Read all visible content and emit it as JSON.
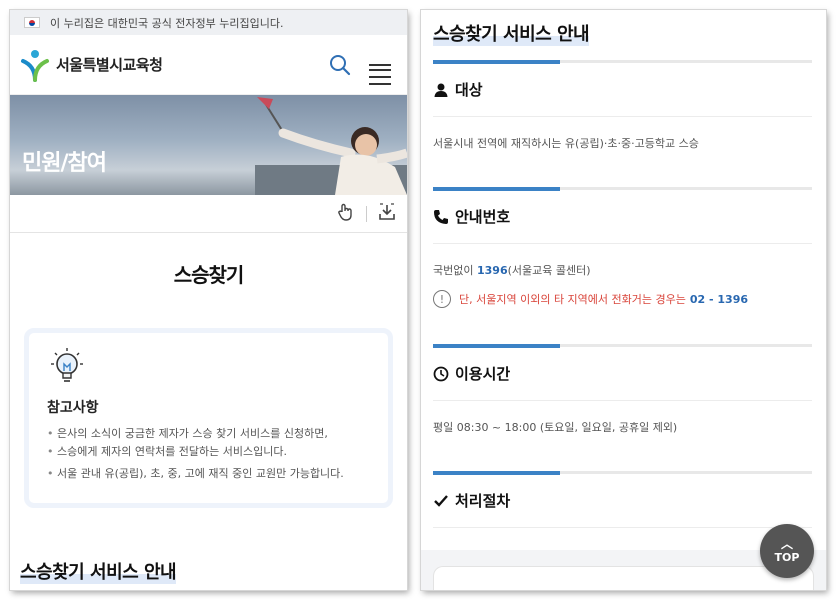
{
  "gov_bar": {
    "text": "이 누리집은 대한민국 공식 전자정부 누리집입니다."
  },
  "header": {
    "logo_text": "서울특별시교육청"
  },
  "banner": {
    "title": "민원/참여"
  },
  "page": {
    "heading": "스승찾기"
  },
  "notice": {
    "title": "참고사항",
    "items": [
      "은사의 소식이 궁금한 제자가 스승 찾기 서비스를 신청하면,",
      "스승에게 제자의 연락처를 전달하는 서비스입니다.",
      "서울 관내 유(공립), 초, 중, 고에 재직 중인 교원만 가능합니다."
    ]
  },
  "section_title": "스승찾기 서비스 안내",
  "sections": {
    "target": {
      "title": "대상",
      "body": "서울시내 전역에 재직하시는 유(공립)·초·중·고등학교 스승"
    },
    "contact": {
      "title": "안내번호",
      "prefix": "국번없이 ",
      "number": "1396",
      "suffix": "(서울교육 콜센터)",
      "warn_icon": "!",
      "warn_text": "단, 서울지역 이외의 타 지역에서 전화거는 경우는 ",
      "warn_number": "02 - 1396"
    },
    "hours": {
      "title": "이용시간",
      "body": "평일 08:30 ~ 18:00 (토요일, 일요일, 공휴일 제외)"
    },
    "process": {
      "title": "처리절차"
    }
  },
  "top_button": {
    "arrow": "︿",
    "label": "TOP"
  },
  "colors": {
    "accent": "#3b82c6",
    "link_blue": "#2867b0",
    "warn_red": "#d9453b"
  },
  "icons": [
    "flag-icon",
    "logo-icon",
    "search-icon",
    "menu-icon",
    "touch-icon",
    "download-icon",
    "lightbulb-icon",
    "user-icon",
    "phone-icon",
    "clock-icon",
    "check-icon"
  ]
}
